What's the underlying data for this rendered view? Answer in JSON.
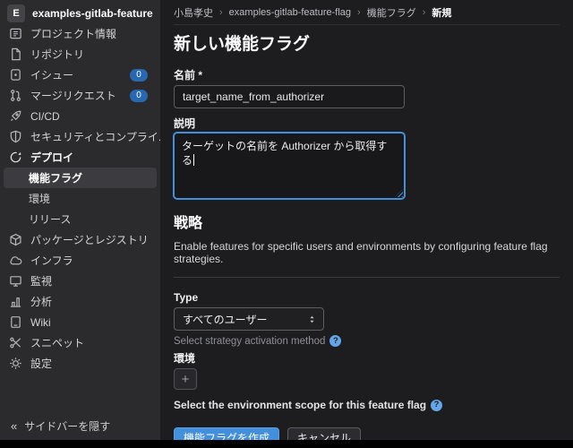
{
  "colors": {
    "accent_blue": "#428fdc",
    "badge_blue": "#2868b2",
    "help_icon_blue": "#63a6e9",
    "sidebar_bg": "#2b2b2e",
    "page_bg": "#1d1d20",
    "selected_item_bg": "#3c3c40"
  },
  "sidebar": {
    "project": {
      "avatar_letter": "E",
      "name": "examples-gitlab-feature-fl..."
    },
    "items": [
      {
        "label": "プロジェクト情報"
      },
      {
        "label": "リポジトリ"
      },
      {
        "label": "イシュー",
        "badge": "0"
      },
      {
        "label": "マージリクエスト",
        "badge": "0"
      },
      {
        "label": "CI/CD"
      },
      {
        "label": "セキュリティとコンプライ..."
      },
      {
        "label": "デプロイ"
      },
      {
        "label": "機能フラグ"
      },
      {
        "label": "環境"
      },
      {
        "label": "リリース"
      },
      {
        "label": "パッケージとレジストリ"
      },
      {
        "label": "インフラ"
      },
      {
        "label": "監視"
      },
      {
        "label": "分析"
      },
      {
        "label": "Wiki"
      },
      {
        "label": "スニペット"
      },
      {
        "label": "設定"
      }
    ],
    "collapse_icon": "«",
    "collapse_label": "サイドバーを隠す"
  },
  "breadcrumb": {
    "sep": "›",
    "items": [
      "小島孝史",
      "examples-gitlab-feature-flag",
      "機能フラグ"
    ],
    "current": "新規"
  },
  "page": {
    "title": "新しい機能フラグ"
  },
  "form": {
    "name_label": "名前",
    "required_mark": "*",
    "name_value": "target_name_from_authorizer",
    "description_label": "説明",
    "description_value": "ターゲットの名前を Authorizer から取得する",
    "strategy_heading": "戦略",
    "strategy_description": "Enable features for specific users and environments by configuring feature flag strategies.",
    "type_label": "Type",
    "type_value": "すべてのユーザー",
    "type_help": "Select strategy activation method",
    "help_mark": "?",
    "environments_label": "環境",
    "add_button_label": "+",
    "environments_help": "Select the environment scope for this feature flag",
    "submit_label": "機能フラグを作成",
    "cancel_label": "キャンセル"
  }
}
